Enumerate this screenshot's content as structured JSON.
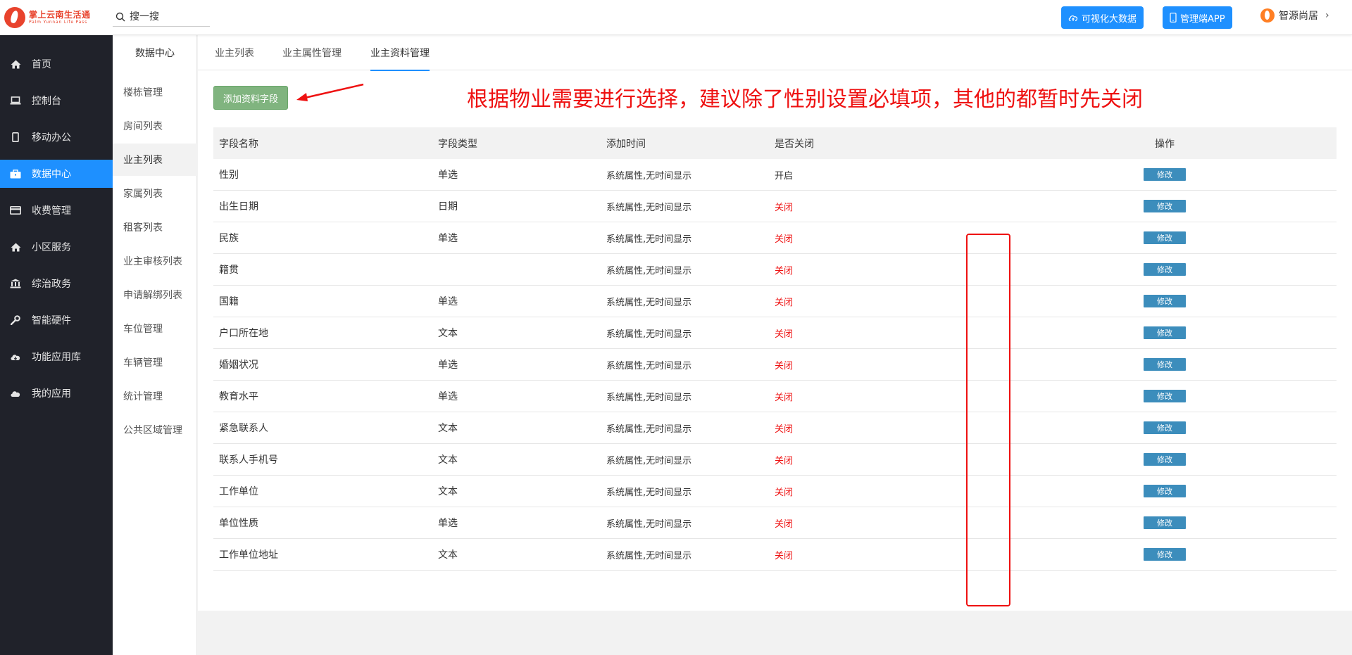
{
  "logo": {
    "cn": "掌上云南生活通",
    "en": "Palm Yunnan Life Pass"
  },
  "search": {
    "placeholder": "搜一搜"
  },
  "header": {
    "btn_bigdata": "可视化大数据",
    "btn_app": "管理端APP",
    "user_name": "智源尚居",
    "accent": "#1e90ff"
  },
  "sidebar": {
    "items": [
      {
        "label": "首页",
        "icon": "home-icon"
      },
      {
        "label": "控制台",
        "icon": "laptop-icon"
      },
      {
        "label": "移动办公",
        "icon": "mobile-icon"
      },
      {
        "label": "数据中心",
        "icon": "briefcase-icon",
        "active": true
      },
      {
        "label": "收费管理",
        "icon": "credit-card-icon"
      },
      {
        "label": "小区服务",
        "icon": "home-icon"
      },
      {
        "label": "综治政务",
        "icon": "bank-icon"
      },
      {
        "label": "智能硬件",
        "icon": "wrench-icon"
      },
      {
        "label": "功能应用库",
        "icon": "cloud-download-icon"
      },
      {
        "label": "我的应用",
        "icon": "cloud-icon"
      }
    ]
  },
  "subnav": {
    "title": "数据中心",
    "items": [
      "楼栋管理",
      "房间列表",
      "业主列表",
      "家属列表",
      "租客列表",
      "业主审核列表",
      "申请解绑列表",
      "车位管理",
      "车辆管理",
      "统计管理",
      "公共区域管理"
    ],
    "active_index": 2
  },
  "tabs": [
    "业主列表",
    "业主属性管理",
    "业主资料管理"
  ],
  "active_tab": 2,
  "add_button": "添加资料字段",
  "annotation": "根据物业需要进行选择，建议除了性别设置必填项，其他的都暂时先关闭",
  "table": {
    "headers": [
      "字段名称",
      "字段类型",
      "添加时间",
      "是否关闭",
      "操作"
    ],
    "rows": [
      {
        "name": "性别",
        "type": "单选",
        "time": "系统属性,无时间显示",
        "status": "开启",
        "action": "修改"
      },
      {
        "name": "出生日期",
        "type": "日期",
        "time": "系统属性,无时间显示",
        "status": "关闭",
        "action": "修改"
      },
      {
        "name": "民族",
        "type": "单选",
        "time": "系统属性,无时间显示",
        "status": "关闭",
        "action": "修改"
      },
      {
        "name": "籍贯",
        "type": "",
        "time": "系统属性,无时间显示",
        "status": "关闭",
        "action": "修改"
      },
      {
        "name": "国籍",
        "type": "单选",
        "time": "系统属性,无时间显示",
        "status": "关闭",
        "action": "修改"
      },
      {
        "name": "户口所在地",
        "type": "文本",
        "time": "系统属性,无时间显示",
        "status": "关闭",
        "action": "修改"
      },
      {
        "name": "婚姻状况",
        "type": "单选",
        "time": "系统属性,无时间显示",
        "status": "关闭",
        "action": "修改"
      },
      {
        "name": "教育水平",
        "type": "单选",
        "time": "系统属性,无时间显示",
        "status": "关闭",
        "action": "修改"
      },
      {
        "name": "紧急联系人",
        "type": "文本",
        "time": "系统属性,无时间显示",
        "status": "关闭",
        "action": "修改"
      },
      {
        "name": "联系人手机号",
        "type": "文本",
        "time": "系统属性,无时间显示",
        "status": "关闭",
        "action": "修改"
      },
      {
        "name": "工作单位",
        "type": "文本",
        "time": "系统属性,无时间显示",
        "status": "关闭",
        "action": "修改"
      },
      {
        "name": "单位性质",
        "type": "单选",
        "time": "系统属性,无时间显示",
        "status": "关闭",
        "action": "修改"
      },
      {
        "name": "工作单位地址",
        "type": "文本",
        "time": "系统属性,无时间显示",
        "status": "关闭",
        "action": "修改"
      }
    ]
  }
}
